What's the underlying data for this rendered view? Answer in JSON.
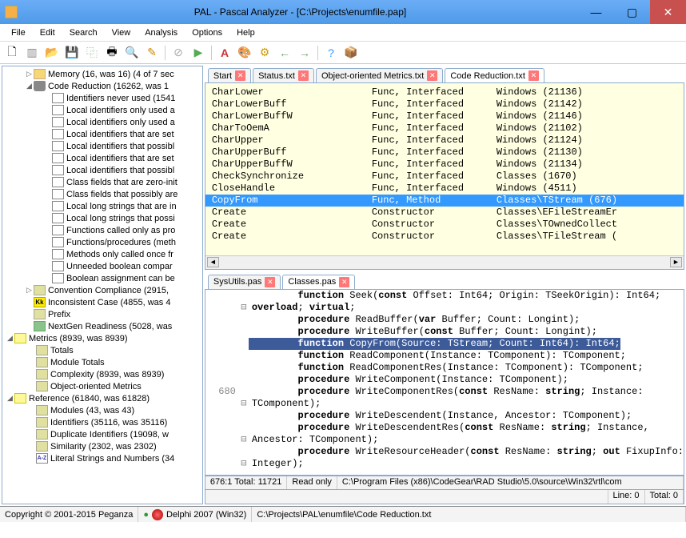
{
  "window": {
    "title": "PAL - Pascal Analyzer - [C:\\Projects\\enumfile.pap]"
  },
  "menu": [
    "File",
    "Edit",
    "Search",
    "View",
    "Analysis",
    "Options",
    "Help"
  ],
  "tree": {
    "memory": "Memory (16, was 16) (4 of 7 sec",
    "codeRed": "Code Reduction (16262, was 1",
    "items": [
      "Identifiers never used (1541",
      "Local identifiers only used a",
      "Local identifiers only used a",
      "Local identifiers that are set",
      "Local identifiers that possibl",
      "Local identifiers that are set",
      "Local identifiers that possibl",
      "Class fields that are zero-init",
      "Class fields that possibly are",
      "Local long strings that are in",
      "Local long strings that possi",
      "Functions called only as pro",
      "Functions/procedures (meth",
      "Methods only called once fr",
      "Unneeded boolean compar",
      "Boolean assignment can be"
    ],
    "conv": "Convention Compliance (2915,",
    "incons": "Inconsistent Case (4855, was 4",
    "prefix": "Prefix",
    "nextgen": "NextGen Readiness (5028, was",
    "metrics": "Metrics (8939, was 8939)",
    "totals": "Totals",
    "modtot": "Module Totals",
    "complex": "Complexity (8939, was 8939)",
    "oom": "Object-oriented Metrics",
    "ref": "Reference (61840, was 61828)",
    "modules": "Modules (43, was 43)",
    "idents": "Identifiers (35116, was 35116)",
    "dup": "Duplicate Identifiers (19098, w",
    "sim": "Similarity (2302, was 2302)",
    "lit": "Literal Strings and Numbers (34"
  },
  "tabs": [
    {
      "label": "Start",
      "x": true
    },
    {
      "label": "Status.txt",
      "x": true
    },
    {
      "label": "Object-oriented Metrics.txt",
      "x": true
    },
    {
      "label": "Code Reduction.txt",
      "x": true,
      "active": true
    }
  ],
  "report": [
    {
      "c1": "CharLower",
      "c2": "Func, Interfaced",
      "c3": "Windows (21136)"
    },
    {
      "c1": "CharLowerBuff",
      "c2": "Func, Interfaced",
      "c3": "Windows (21142)"
    },
    {
      "c1": "CharLowerBuffW",
      "c2": "Func, Interfaced",
      "c3": "Windows (21146)"
    },
    {
      "c1": "CharToOemA",
      "c2": "Func, Interfaced",
      "c3": "Windows (21102)"
    },
    {
      "c1": "CharUpper",
      "c2": "Func, Interfaced",
      "c3": "Windows (21124)"
    },
    {
      "c1": "CharUpperBuff",
      "c2": "Func, Interfaced",
      "c3": "Windows (21130)"
    },
    {
      "c1": "CharUpperBuffW",
      "c2": "Func, Interfaced",
      "c3": "Windows (21134)"
    },
    {
      "c1": "CheckSynchronize",
      "c2": "Func, Interfaced",
      "c3": "Classes (1670)"
    },
    {
      "c1": "CloseHandle",
      "c2": "Func, Interfaced",
      "c3": "Windows (4511)"
    },
    {
      "c1": "CopyFrom",
      "c2": "Func, Method",
      "c3": "Classes\\TStream (676)",
      "sel": true
    },
    {
      "c1": "Create",
      "c2": "Constructor",
      "c3": "Classes\\EFileStreamEr"
    },
    {
      "c1": "Create",
      "c2": "Constructor",
      "c3": "Classes\\TOwnedCollect"
    },
    {
      "c1": "Create",
      "c2": "Constructor",
      "c3": "Classes\\TFileStream ("
    }
  ],
  "srctabs": [
    {
      "label": "SysUtils.pas",
      "x": true
    },
    {
      "label": "Classes.pas",
      "x": true,
      "active": true
    }
  ],
  "source": {
    "lines": [
      {
        "n": "",
        "f": "",
        "t": "        function Seek(const Offset: Int64; Origin: TSeekOrigin): Int64;"
      },
      {
        "n": "",
        "f": "⊟",
        "t": "overload; virtual;"
      },
      {
        "n": "",
        "f": "",
        "t": "        procedure ReadBuffer(var Buffer; Count: Longint);"
      },
      {
        "n": "",
        "f": "",
        "t": "        procedure WriteBuffer(const Buffer; Count: Longint);"
      },
      {
        "n": "",
        "f": "",
        "t": "        function CopyFrom(Source: TStream; Count: Int64): Int64;",
        "hl": true
      },
      {
        "n": "",
        "f": "",
        "t": "        function ReadComponent(Instance: TComponent): TComponent;"
      },
      {
        "n": "",
        "f": "",
        "t": "        function ReadComponentRes(Instance: TComponent): TComponent;"
      },
      {
        "n": "",
        "f": "",
        "t": "        procedure WriteComponent(Instance: TComponent);"
      },
      {
        "n": "680",
        "f": "",
        "t": "        procedure WriteComponentRes(const ResName: string; Instance:"
      },
      {
        "n": "",
        "f": "⊟",
        "t": "TComponent);"
      },
      {
        "n": "",
        "f": "",
        "t": "        procedure WriteDescendent(Instance, Ancestor: TComponent);"
      },
      {
        "n": "",
        "f": "",
        "t": "        procedure WriteDescendentRes(const ResName: string; Instance,"
      },
      {
        "n": "",
        "f": "⊟",
        "t": "Ancestor: TComponent);"
      },
      {
        "n": "",
        "f": "",
        "t": "        procedure WriteResourceHeader(const ResName: string; out FixupInfo:"
      },
      {
        "n": "",
        "f": "⊟",
        "t": "Integer);"
      }
    ]
  },
  "srcstatus": {
    "pos": "676:1 Total: 11721",
    "mode": "Read only",
    "path": "C:\\Program Files (x86)\\CodeGear\\RAD Studio\\5.0\\source\\Win32\\rtl\\com"
  },
  "status": {
    "line": "Line: 0",
    "total": "Total: 0"
  },
  "footer": {
    "copyright": "Copyright © 2001-2015 Peganza",
    "compiler": "Delphi 2007 (Win32)",
    "path": "C:\\Projects\\PAL\\enumfile\\Code Reduction.txt"
  }
}
